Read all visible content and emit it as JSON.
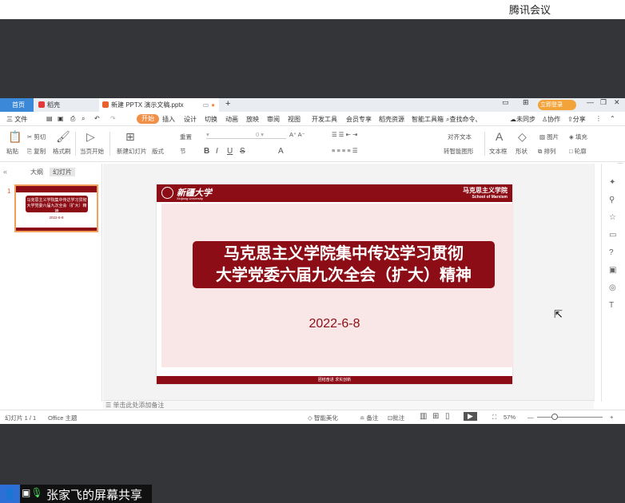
{
  "meeting_title": "腾讯会议",
  "tabs": {
    "home": "首页",
    "daoke": "稻壳",
    "document": "新建 PPTX 演示文稿.pptx",
    "login": "立即登录"
  },
  "menu": [
    "三 文件",
    "开始",
    "插入",
    "设计",
    "切换",
    "动画",
    "放映",
    "审阅",
    "视图",
    "开发工具",
    "会员专享",
    "稻壳资源",
    "智能工具箱",
    "查找命令、",
    "未同步",
    "协作",
    "分享"
  ],
  "ribbon": {
    "paste": "粘贴",
    "cut": "剪切",
    "copy": "复制",
    "format_painter": "格式刷",
    "play_from_current": "当页开始",
    "new_slide": "新建幻灯片",
    "layout": "版式",
    "section": "节",
    "reset": "重置",
    "text_box": "文本框",
    "shape": "形状",
    "arrange": "排列",
    "picture": "图片",
    "fill": "填充",
    "outline": "轮廓",
    "smart_shapes": "转智能图形",
    "align_text": "对齐文本"
  },
  "left_panel": {
    "tab_outline": "大纲",
    "tab_slides": "幻灯片",
    "slide_number": "1"
  },
  "slide": {
    "university_cn": "新疆大学",
    "university_en": "Xinjiang University",
    "school_cn": "马克思主义学院",
    "school_en": "School of Marxism",
    "title_line1": "马克思主义学院集中传达学习贯彻",
    "title_line2": "大学党委六届九次全会（扩大）精神",
    "date": "2022-6-8",
    "footer": "团结奋进  求实创新"
  },
  "thumbnail": {
    "title_line1": "马克思主义学院集中传达学习贯彻",
    "title_line2": "大学党委六届九次全会（扩大）精神",
    "date": "2022-6-8"
  },
  "notes_placeholder": "单击此处添加备注",
  "status": {
    "slide_count": "幻灯片 1 / 1",
    "theme": "Office 主题",
    "smart_beautify": "智能美化",
    "notes": "备注",
    "comments": "批注",
    "zoom": "57%"
  },
  "share": {
    "label": "张家飞的屏幕共享"
  }
}
